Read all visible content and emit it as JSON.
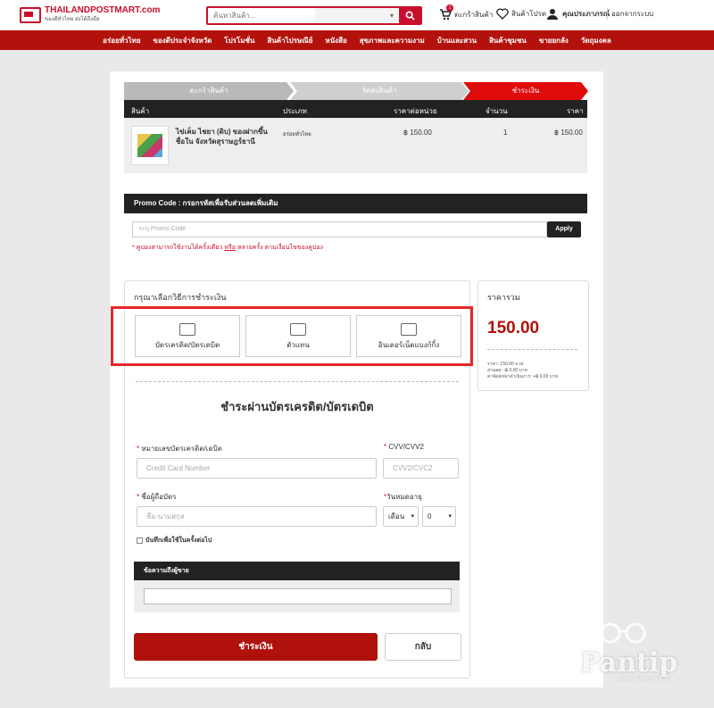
{
  "header": {
    "logo_main": "THAILANDPOSTMART.com",
    "logo_tag": "ของดีทั่วไทย ส่งได้ถึงมือ",
    "search_placeholder": "ค้นหาสินค้า...",
    "cart_label": "ตะกร้าสินค้า",
    "cart_count": "1",
    "wishlist_label": "สินค้าโปรด",
    "user_name": "คุณประภาภรณ์",
    "logout_label": "ออกจากระบบ"
  },
  "nav": [
    "อร่อยทั่วไทย",
    "ของดีประจำจังหวัด",
    "โปรโมชั่น",
    "สินค้าไปรษณีย์",
    "หนังสือ",
    "สุขภาพและความงาม",
    "บ้านและสวน",
    "สินค้าชุมชน",
    "ขายยกลัง",
    "วัตถุมงคล"
  ],
  "steps": [
    "ตะกร้าสินค้า",
    "จัดส่งสินค้า",
    "ชำระเงิน"
  ],
  "table": {
    "headers": [
      "สินค้า",
      "ประเภท",
      "ราคาต่อหน่วย",
      "จำนวน",
      "ราคา"
    ],
    "row": {
      "name": "ไข่เค็ม ไชยา (ดิบ) ของฝากขึ้นชื่อใน จังหวัดสุราษฎร์ธานี",
      "category": "อร่อยทั่วไทย",
      "unit_price": "฿ 150.00",
      "qty": "1",
      "price": "฿ 150.00"
    }
  },
  "promo": {
    "bar_label": "Promo Code : กรอกรหัสเพื่อรับส่วนลดเพิ่มเติม",
    "placeholder": "ระบุ Promo Code",
    "apply_label": "Apply",
    "note_a": "* คูปองสามารถใช้งานได้ครั้งเดียว",
    "note_or": "หรือ",
    "note_b": "หลายครั้ง ตามเงื่อนไขของคูปอง"
  },
  "payment": {
    "title": "กรุณาเลือกวิธีการชำระเงิน",
    "methods": [
      "บัตรเครดิต/บัตรเดบิต",
      "ตัวแทน",
      "อินเตอร์เน็ตแบงก์กิ้ง"
    ],
    "form_title": "ชำระผ่านบัตรเครดิต/บัตรเดบิต",
    "card_number_label": "หมายเลขบัตรเครดิต/เดบิต",
    "card_number_placeholder": "Credit Card Number",
    "cvv_label": "CVV/CVV2",
    "cvv_placeholder": "CVV2/CVC2",
    "holder_label": "ชื่อผู้ถือบัตร",
    "holder_placeholder": "ชื่อ-นามสกุล",
    "expiry_label": "วันหมดอายุ",
    "month_value": "เดือน",
    "year_value": "0",
    "save_label": "บันทึกเพื่อใช้ในครั้งต่อไป",
    "message_label": "ข้อความถึงผู้ขาย",
    "pay_label": "ชำระเงิน",
    "back_label": "กลับ"
  },
  "summary": {
    "title": "ราคารวม",
    "total": "150.00",
    "line1": "ราคา: 150.00 บาท",
    "line2": "ส่วนลด: -฿ 0.00 บาท",
    "line3": "ค่าจัดส่ง/ค่าดำเนินการ: +฿ 0.00 บาท"
  },
  "watermark": {
    "brand": "Pantip",
    "slogan": "Learn, Share & Fun"
  },
  "colors": {
    "accent": "#b3120c",
    "highlight": "#e8262a",
    "dark": "#222222"
  }
}
